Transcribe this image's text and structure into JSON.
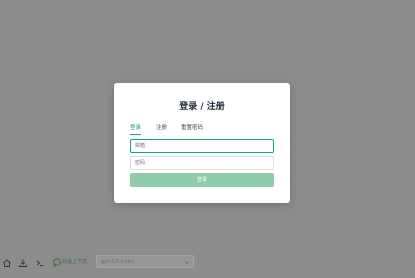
{
  "modal": {
    "title": "登录 / 注册",
    "tabs": [
      {
        "label": "登录",
        "active": true
      },
      {
        "label": "注册",
        "active": false
      },
      {
        "label": "重置密码",
        "active": false
      }
    ],
    "username_placeholder": "邮箱",
    "password_placeholder": "密码",
    "submit_label": "登录"
  },
  "toolbar": {
    "chat_label": "对话上下文",
    "model_value": "gpt-3.5-turbo"
  },
  "colors": {
    "backdrop": "#8c8c8c",
    "accent": "#10a37f",
    "submit_disabled": "#8fccab"
  },
  "icons": [
    "home-icon",
    "download-icon",
    "terminal-icon",
    "chat-icon",
    "chevron-down-icon"
  ]
}
